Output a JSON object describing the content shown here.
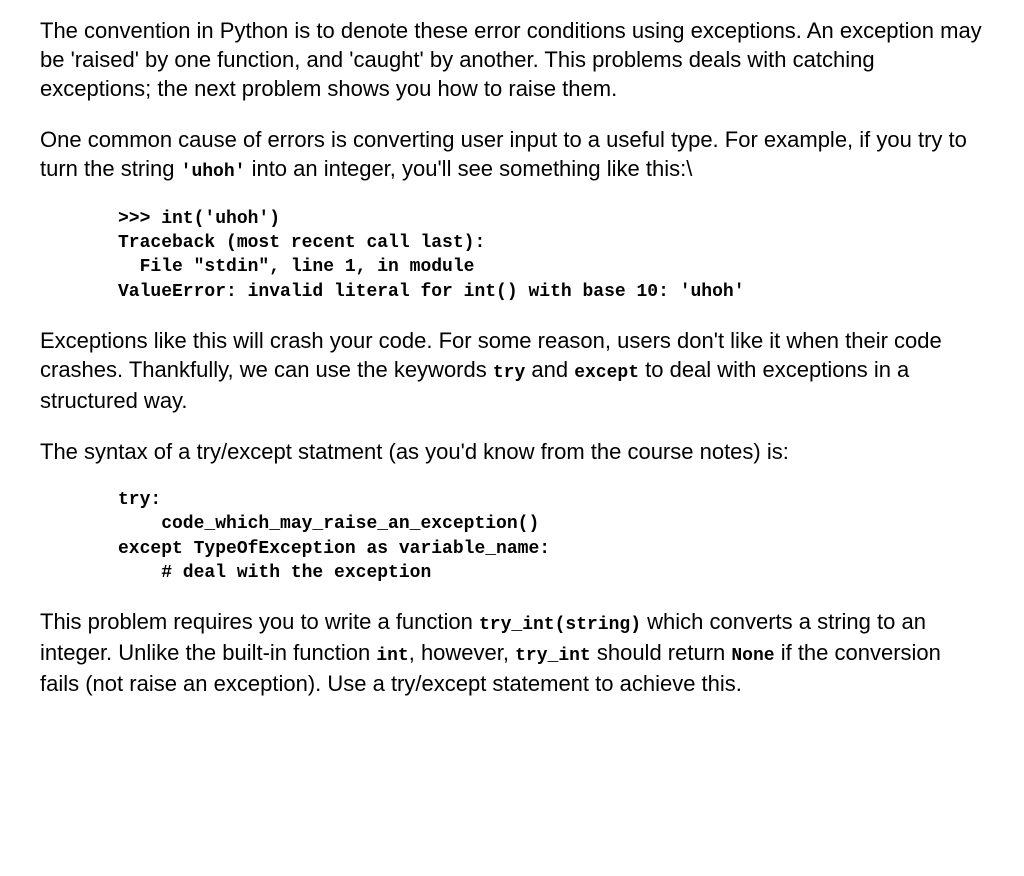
{
  "paragraphs": {
    "p1": {
      "text": "The convention in Python is to denote these error conditions using exceptions. An exception may be 'raised' by one function, and 'caught' by another. This problems deals with catching exceptions; the next problem shows you how to raise them."
    },
    "p2": {
      "t1": "One common cause of errors is converting user input to a useful type. For example, if you try to turn the string ",
      "c1": "'uhoh'",
      "t2": " into an integer, you'll see something like this:\\"
    },
    "code1": ">>> int('uhoh')\nTraceback (most recent call last):\n  File \"stdin\", line 1, in module\nValueError: invalid literal for int() with base 10: 'uhoh'",
    "p3": {
      "t1": "Exceptions like this will crash your code. For some reason, users don't like it when their code crashes. Thankfully, we can use the keywords ",
      "c1": "try",
      "t2": " and ",
      "c2": "except",
      "t3": " to deal with exceptions in a structured way."
    },
    "p4": {
      "text": "The syntax of a try/except statment (as you'd know from the course notes) is:"
    },
    "code2": "try:\n    code_which_may_raise_an_exception()\nexcept TypeOfException as variable_name:\n    # deal with the exception",
    "p5": {
      "t1": "This problem requires you to write a function ",
      "c1": "try_int(string)",
      "t2": " which converts a string to an integer. Unlike the built-in function ",
      "c2": "int",
      "t3": ", however, ",
      "c3": "try_int",
      "t4": " should return ",
      "c4": "None",
      "t5": " if the conversion fails (not raise an exception). Use a try/except statement to achieve this."
    }
  }
}
